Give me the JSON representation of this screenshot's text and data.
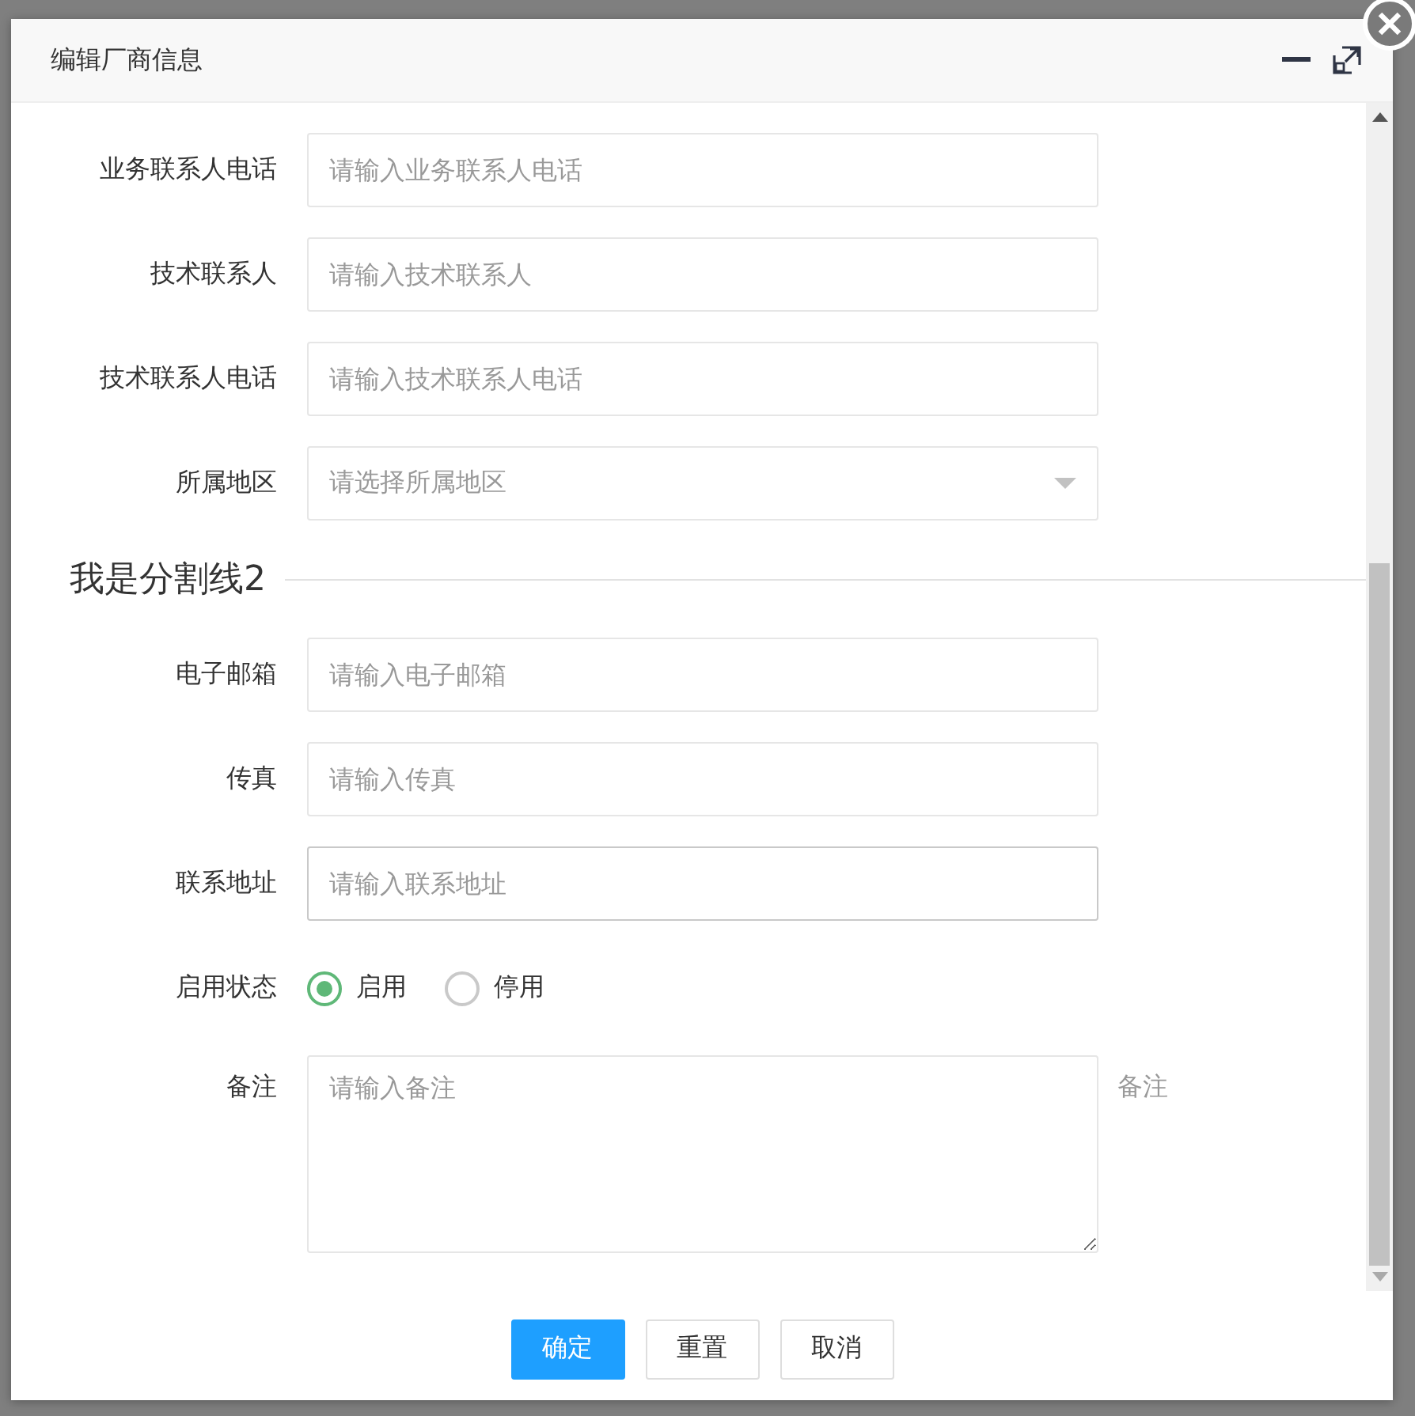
{
  "dialog": {
    "title": "编辑厂商信息"
  },
  "form": [
    {
      "kind": "input",
      "label": "业务联系人电话",
      "placeholder": "请输入业务联系人电话",
      "focused": false
    },
    {
      "kind": "input",
      "label": "技术联系人",
      "placeholder": "请输入技术联系人",
      "focused": false
    },
    {
      "kind": "input",
      "label": "技术联系人电话",
      "placeholder": "请输入技术联系人电话",
      "focused": false
    },
    {
      "kind": "select",
      "label": "所属地区",
      "placeholder": "请选择所属地区"
    },
    {
      "kind": "divider",
      "label": "我是分割线2"
    },
    {
      "kind": "input",
      "label": "电子邮箱",
      "placeholder": "请输入电子邮箱",
      "focused": false
    },
    {
      "kind": "input",
      "label": "传真",
      "placeholder": "请输入传真",
      "focused": false
    },
    {
      "kind": "input",
      "label": "联系地址",
      "placeholder": "请输入联系地址",
      "focused": true
    },
    {
      "kind": "radio",
      "label": "启用状态",
      "options": [
        {
          "label": "启用",
          "selected": true
        },
        {
          "label": "停用",
          "selected": false
        }
      ]
    },
    {
      "kind": "textarea",
      "label": "备注",
      "placeholder": "请输入备注",
      "hint": "备注"
    }
  ],
  "buttons": [
    {
      "label": "确定",
      "primary": true
    },
    {
      "label": "重置",
      "primary": false
    },
    {
      "label": "取消",
      "primary": false
    }
  ]
}
